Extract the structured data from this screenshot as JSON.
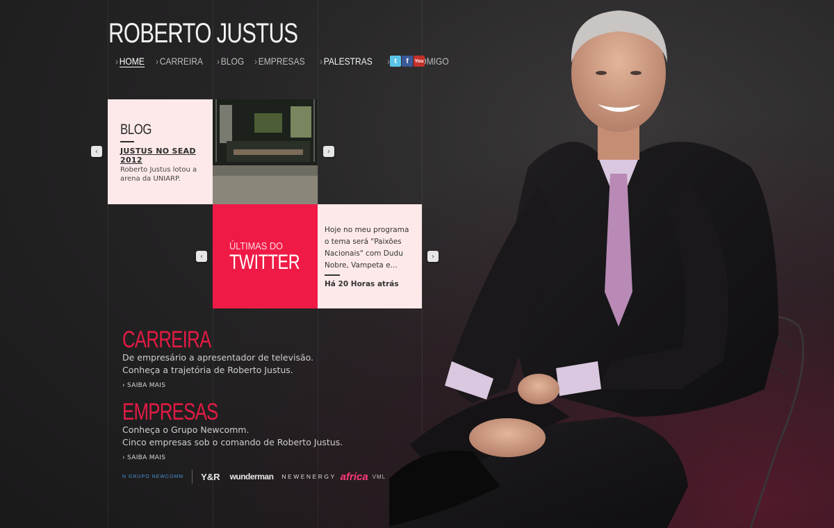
{
  "brand": {
    "title": "ROBERTO JUSTUS"
  },
  "nav": {
    "items": [
      {
        "label": "HOME",
        "chevron": "›"
      },
      {
        "label": "CARREIRA",
        "chevron": "›"
      },
      {
        "label": "BLOG",
        "chevron": "›"
      },
      {
        "label": "EMPRESAS",
        "chevron": "›"
      },
      {
        "label": "PALESTRAS",
        "chevron": "›"
      },
      {
        "label": "FALE COMIGO",
        "chevron": "›"
      }
    ]
  },
  "social": {
    "twitter": "t",
    "facebook": "f",
    "youtube": "You"
  },
  "blog": {
    "heading": "BLOG",
    "post_title_line1": "JUSTUS NO SEAD",
    "post_title_line2": "2012",
    "post_text": "Roberto Justus lotou a arena da UNIARP."
  },
  "twitter_block": {
    "small": "ÚLTIMAS DO",
    "big": "TWITTER",
    "tweet": "Hoje no meu programa o tema será \"Paixões Nacionais\" com Dudu Nobre, Vampeta e...",
    "time": "Há 20 Horas atrás"
  },
  "arrows": {
    "prev": "‹",
    "next": "›"
  },
  "carreira": {
    "title": "CARREIRA",
    "line1": "De empresário a apresentador de televisão.",
    "line2": "Conheça a trajetória de Roberto Justus.",
    "more": "› SAIBA MAIS"
  },
  "empresas": {
    "title": "EMPRESAS",
    "line1": "Conheça o Grupo Newcomm.",
    "line2": "Cinco empresas sob o comando de Roberto Justus.",
    "more": "› SAIBA MAIS"
  },
  "partner_logos": {
    "newcomm": "N GRUPO NEWCOMM",
    "yr": "Y&R",
    "wunderman": "wunderman",
    "newenergy": "NEWENERGY",
    "africa": "africa",
    "vml": "VML"
  },
  "colors": {
    "accent": "#e31b44",
    "card": "#fde9ea",
    "twitter_red": "#ef1b46"
  }
}
